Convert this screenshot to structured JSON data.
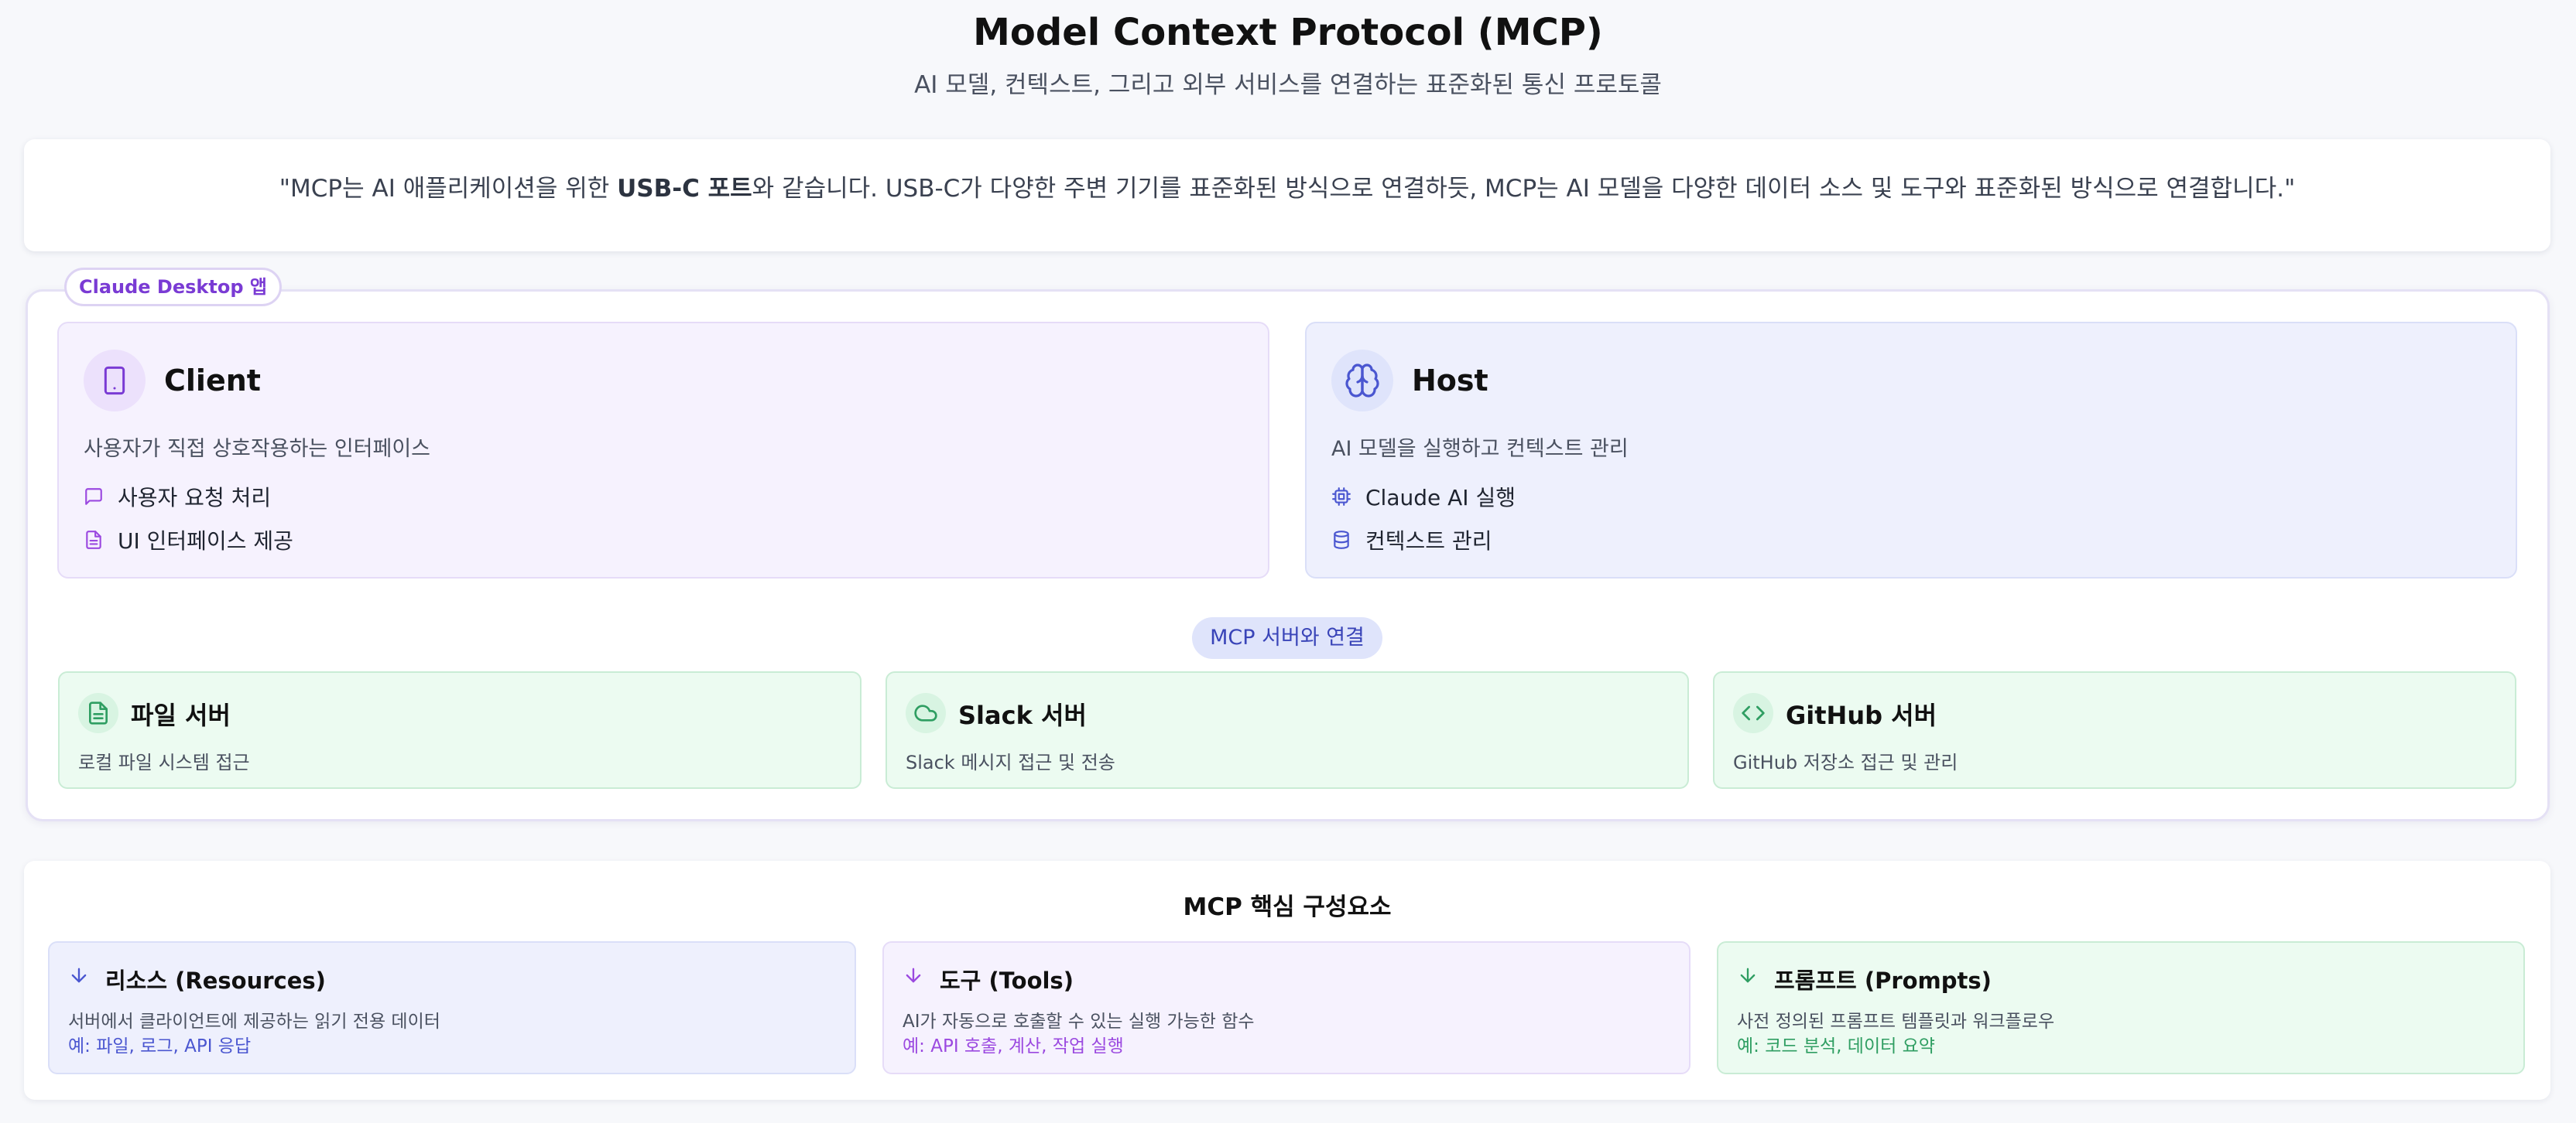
{
  "header": {
    "title": "Model Context Protocol (MCP)",
    "subtitle": "AI 모델, 컨텍스트, 그리고 외부 서비스를 연결하는 표준화된 통신 프로토콜"
  },
  "quote": {
    "before": "\"MCP는 AI 애플리케이션을 위한 ",
    "bold": "USB-C 포트",
    "after": "와 같습니다. USB-C가 다양한 주변 기기를 표준화된 방식으로 연결하듯, MCP는 AI 모델을 다양한 데이터 소스 및 도구와 표준화된 방식으로 연결합니다.\""
  },
  "app": {
    "label": "Claude Desktop 앱",
    "client": {
      "icon": "tablet-icon",
      "title": "Client",
      "description": "사용자가 직접 상호작용하는 인터페이스",
      "features": [
        {
          "icon": "message-square-icon",
          "label": "사용자 요청 처리"
        },
        {
          "icon": "file-text-icon",
          "label": "UI 인터페이스 제공"
        }
      ]
    },
    "host": {
      "icon": "brain-icon",
      "title": "Host",
      "description": "AI 모델을 실행하고 컨텍스트 관리",
      "features": [
        {
          "icon": "cpu-icon",
          "label": "Claude AI 실행"
        },
        {
          "icon": "database-icon",
          "label": "컨텍스트 관리"
        }
      ]
    },
    "connection_label": "MCP 서버와 연결",
    "servers": [
      {
        "icon": "file-icon",
        "title": "파일 서버",
        "description": "로컬 파일 시스템 접근"
      },
      {
        "icon": "cloud-icon",
        "title": "Slack 서버",
        "description": "Slack 메시지 접근 및 전송"
      },
      {
        "icon": "code-icon",
        "title": "GitHub 서버",
        "description": "GitHub 저장소 접근 및 관리"
      }
    ]
  },
  "core": {
    "title": "MCP 핵심 구성요소",
    "items": [
      {
        "icon": "arrow-down-icon",
        "name": "리소스 (Resources)",
        "description": "서버에서 클라이언트에 제공하는 읽기 전용 데이터",
        "example": "예: 파일, 로그, API 응답"
      },
      {
        "icon": "arrow-down-icon",
        "name": "도구 (Tools)",
        "description": "AI가 자동으로 호출할 수 있는 실행 가능한 함수",
        "example": "예: API 호출, 계산, 작업 실행"
      },
      {
        "icon": "arrow-down-icon",
        "name": "프롬프트 (Prompts)",
        "description": "사전 정의된 프롬프트 템플릿과 워크플로우",
        "example": "예: 코드 분석, 데이터 요약"
      }
    ]
  },
  "colors": {
    "client_accent": "#7a3bd4",
    "host_accent": "#4a56d0",
    "server_accent": "#2f9e62"
  }
}
